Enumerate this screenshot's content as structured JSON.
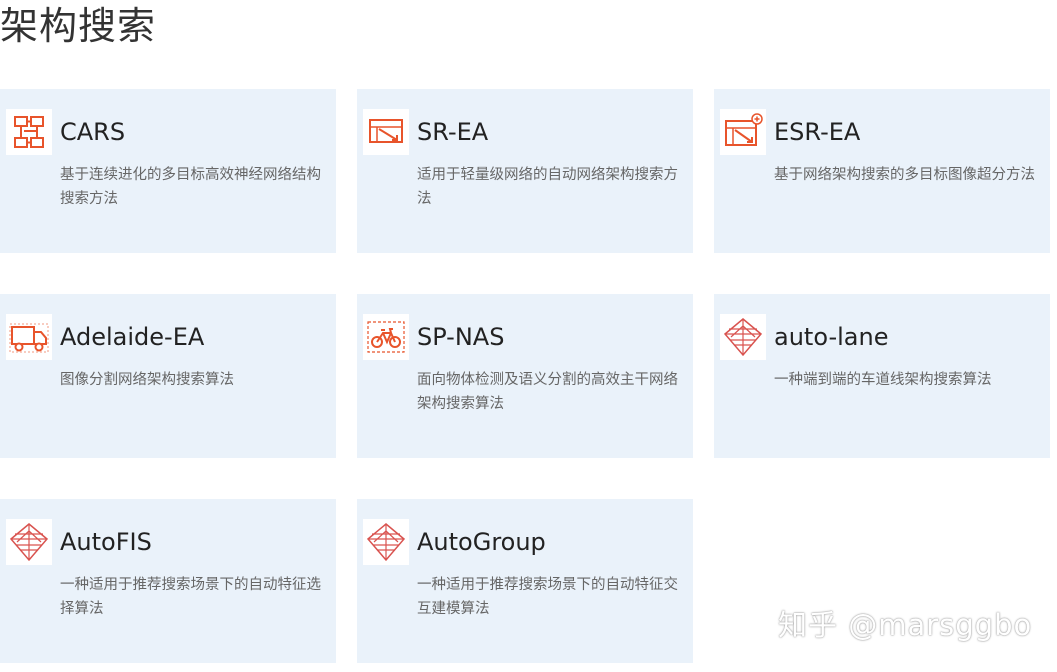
{
  "page": {
    "title": "架构搜索"
  },
  "colors": {
    "card_bg": "#eaf2fa",
    "icon_accent": "#e8542b",
    "icon_accent_red": "#d9534f"
  },
  "cards": [
    {
      "name": "CARS",
      "desc": "基于连续进化的多目标高效神经网络结构搜索方法",
      "icon": "flowchart-icon"
    },
    {
      "name": "SR-EA",
      "desc": "适用于轻量级网络的自动网络架构搜索方法",
      "icon": "image-grid-icon"
    },
    {
      "name": "ESR-EA",
      "desc": "基于网络架构搜索的多目标图像超分方法",
      "icon": "image-upscale-icon"
    },
    {
      "name": "Adelaide-EA",
      "desc": "图像分割网络架构搜索算法",
      "icon": "truck-icon"
    },
    {
      "name": "SP-NAS",
      "desc": "面向物体检测及语义分割的高效主干网络架构搜索算法",
      "icon": "bicycle-icon"
    },
    {
      "name": "auto-lane",
      "desc": "一种端到端的车道线架构搜索算法",
      "icon": "lane-icon"
    },
    {
      "name": "AutoFIS",
      "desc": "一种适用于推荐搜索场景下的自动特征选择算法",
      "icon": "lane-icon"
    },
    {
      "name": "AutoGroup",
      "desc": "一种适用于推荐搜索场景下的自动特征交互建模算法",
      "icon": "lane-icon"
    }
  ],
  "watermark": "知乎 @marsggbo"
}
